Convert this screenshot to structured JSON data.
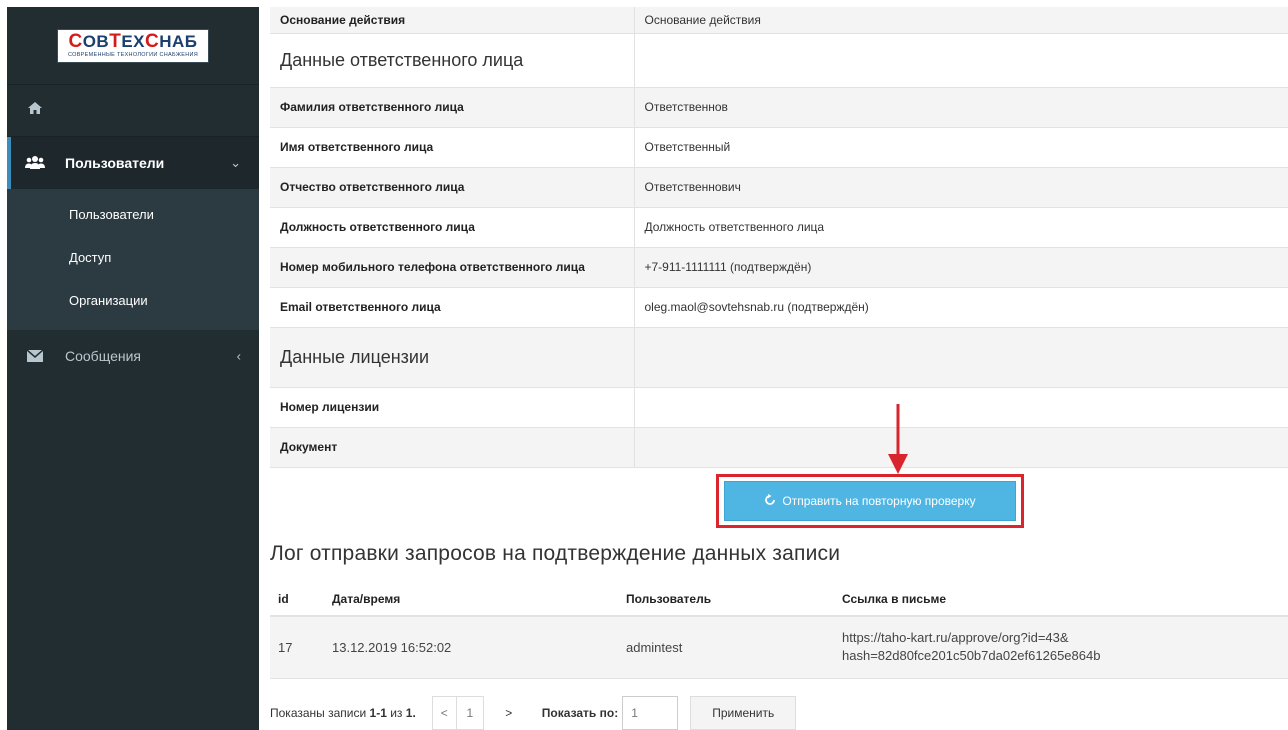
{
  "brand": {
    "logo_main_1": "С",
    "logo_main_2": "ОВ",
    "logo_main_3": "Т",
    "logo_main_4": "ЕХ",
    "logo_main_5": "С",
    "logo_main_6": "НАБ",
    "logo_sub": "СОВРЕМЕННЫЕ ТЕХНОЛОГИИ СНАБЖЕНИЯ"
  },
  "sidebar": {
    "home_icon": "home-icon",
    "users": {
      "label": "Пользователи",
      "icon": "users-icon",
      "caret": "⌄"
    },
    "sub_items": [
      "Пользователи",
      "Доступ",
      "Организации"
    ],
    "messages": {
      "label": "Сообщения",
      "icon": "envelope-icon",
      "caret": "‹"
    }
  },
  "details": {
    "row0": {
      "label": "Основание действия",
      "value": "Основание действия"
    },
    "section_responsible": "Данные ответственного лица",
    "rows": [
      {
        "label": "Фамилия ответственного лица",
        "value": "Ответственнов"
      },
      {
        "label": "Имя ответственного лица",
        "value": "Ответственный"
      },
      {
        "label": "Отчество ответственного лица",
        "value": "Ответственнович"
      },
      {
        "label": "Должность ответственного лица",
        "value": "Должность ответственного лица"
      },
      {
        "label": "Номер мобильного телефона ответственного лица",
        "value": "+7-911-1111111 (подтверждён)"
      },
      {
        "label": "Email ответственного лица",
        "value": "oleg.maol@sovtehsnab.ru (подтверждён)"
      }
    ],
    "section_license": "Данные лицензии",
    "license_rows": [
      {
        "label": "Номер лицензии",
        "value": ""
      },
      {
        "label": "Документ",
        "value": ""
      }
    ]
  },
  "resend_button": {
    "label": "Отправить на повторную проверку",
    "icon": "refresh-icon"
  },
  "log": {
    "title": "Лог отправки запросов на подтверждение данных записи",
    "headers": [
      "id",
      "Дата/время",
      "Пользователь",
      "Ссылка в письме"
    ],
    "rows": [
      {
        "id": "17",
        "datetime": "13.12.2019 16:52:02",
        "user": "admintest",
        "link_line1": "https://taho-kart.ru/approve/org?id=43&",
        "link_line2": "hash=82d80fce201c50b7da02ef61265e864b"
      }
    ]
  },
  "pager": {
    "shown_prefix": "Показаны записи ",
    "range": "1-1",
    "of": " из ",
    "total": "1",
    "dot": ".",
    "prev": "<",
    "page": "1",
    "next": ">",
    "per_page_label": "Показать по:",
    "per_page_value": "1",
    "apply": "Применить"
  },
  "colors": {
    "sidebar_bg": "#222d32",
    "accent": "#3c8dbc",
    "button_bg": "#4fb6e4",
    "highlight_red": "#d9262e"
  }
}
